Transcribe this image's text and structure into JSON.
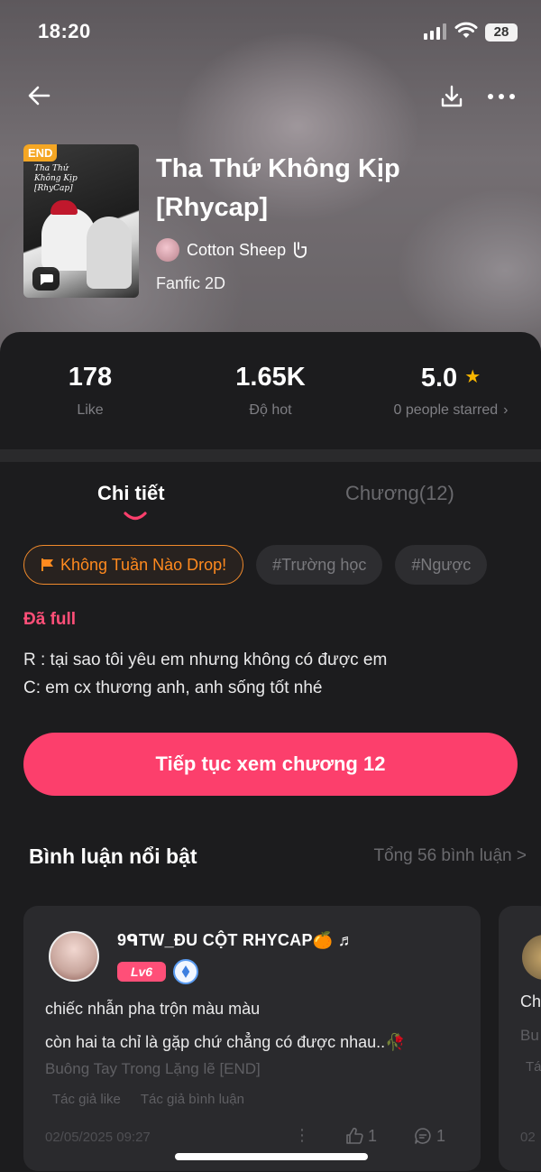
{
  "status_bar": {
    "time": "18:20",
    "battery": "28"
  },
  "story": {
    "title": "Tha Thứ Không Kịp [Rhycap]",
    "author": "Cotton Sheep",
    "genre": "Fanfic 2D",
    "cover_badge": "END",
    "cover_text_line1": "Tha Thứ",
    "cover_text_line2": "Không Kịp",
    "cover_text_line3": "[RhyCap]"
  },
  "stats": {
    "likes_value": "178",
    "likes_label": "Like",
    "hot_value": "1.65K",
    "hot_label": "Độ hot",
    "rating_value": "5.0",
    "rating_label": "0 people starred"
  },
  "tabs": {
    "details": "Chi tiết",
    "chapters": "Chương(12)"
  },
  "tags": [
    "Không Tuần Nào Drop!",
    "#Trường học",
    "#Ngược"
  ],
  "status_label": "Đã full",
  "description": {
    "line1": "R : tại sao tôi yêu em nhưng không có được em",
    "line2": "C: em cx thương anh, anh sống tốt nhé"
  },
  "continue_button": "Tiếp tục xem chương 12",
  "comments": {
    "title": "Bình luận nổi bật",
    "total": "Tổng 56 bình luận >",
    "items": [
      {
        "username": "9ᑫTW_ĐU CỘT RHYCAP🍊 ♬",
        "level": "Lv6",
        "line1": "chiếc nhẫn pha trộn màu màu",
        "line2": "còn hai ta chỉ là gặp chứ chẳng có được nhau..🥀",
        "source": "Buông Tay Trong Lặng lẽ [END]",
        "tag1": "Tác giả like",
        "tag2": "Tác giả bình luận",
        "date": "02/05/2025 09:27",
        "likes": "1",
        "replies": "1"
      }
    ],
    "next_card": {
      "text1": "Ch",
      "text2": "Bu",
      "text3": "Tá",
      "text4": "02"
    }
  },
  "colors": {
    "accent": "#fc3f6c",
    "status_pink": "#ff4f78",
    "tag_orange": "#ff8a1f",
    "star": "#f7b500"
  }
}
